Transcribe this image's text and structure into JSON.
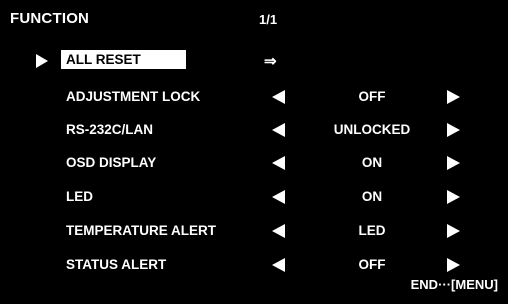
{
  "menu": {
    "title": "FUNCTION",
    "page": "1/1",
    "enter_symbol": "⇒",
    "items": [
      {
        "label": "ALL RESET"
      },
      {
        "label": "ADJUSTMENT LOCK",
        "value": "OFF"
      },
      {
        "label": "RS-232C/LAN",
        "value": "UNLOCKED"
      },
      {
        "label": "OSD DISPLAY",
        "value": "ON"
      },
      {
        "label": "LED",
        "value": "ON"
      },
      {
        "label": "TEMPERATURE ALERT",
        "value": "LED"
      },
      {
        "label": "STATUS ALERT",
        "value": "OFF"
      }
    ],
    "footer_hint": "END···[MENU]"
  },
  "colors": {
    "background": "#000000",
    "text": "#ffffff",
    "highlight_bg": "#ffffff",
    "highlight_text": "#000000"
  }
}
